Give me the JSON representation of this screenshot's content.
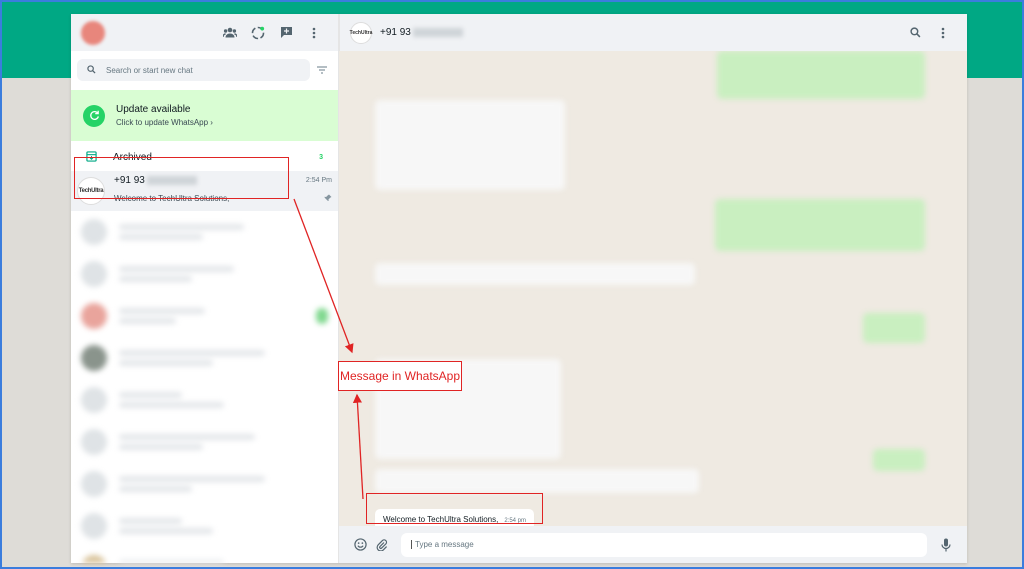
{
  "left_panel": {
    "header": {
      "icons": [
        "communities-icon",
        "status-icon",
        "new-chat-icon",
        "menu-icon"
      ]
    },
    "search": {
      "placeholder": "Search or start new chat"
    },
    "update_banner": {
      "title": "Update available",
      "subtitle": "Click to update WhatsApp ›"
    },
    "archived": {
      "label": "Archived",
      "count": "3"
    },
    "chat_item": {
      "avatar_text": "TechUltra",
      "name": "+91 93",
      "time": "2:54 Pm",
      "preview": "Welcome to TechUltra Solutions,"
    }
  },
  "right_panel": {
    "header": {
      "avatar_text": "TechUltra",
      "name": "+91 93",
      "icons": [
        "search-icon",
        "menu-icon"
      ]
    },
    "message": {
      "text": "Welcome to TechUltra Solutions,",
      "time": "2:54 pm"
    },
    "composer": {
      "placeholder": "Type a message"
    }
  },
  "annotation": {
    "label": "Message in WhatsApp"
  },
  "colors": {
    "brand": "#00a884",
    "update_banner_bg": "#d9fdd3",
    "annotation": "#e02424"
  }
}
